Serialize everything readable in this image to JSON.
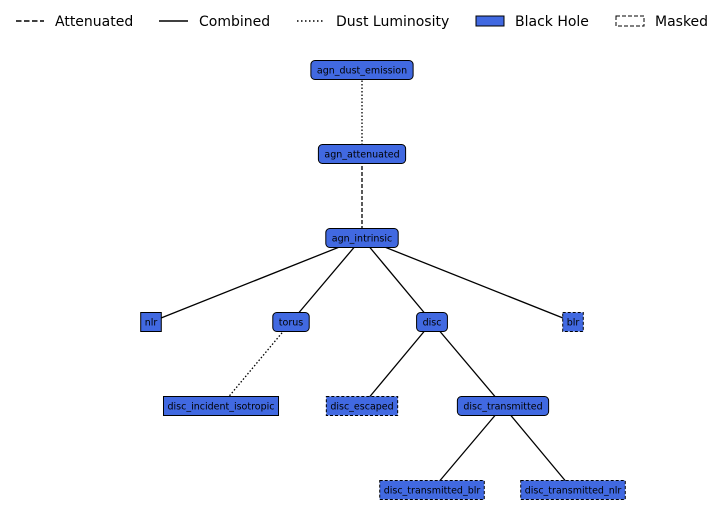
{
  "colors": {
    "node_fill": "#4169e1",
    "edge": "#000000",
    "background": "#ffffff"
  },
  "legend": [
    {
      "label": "Attenuated",
      "style": "dashed-line"
    },
    {
      "label": "Combined",
      "style": "solid-line"
    },
    {
      "label": "Dust Luminosity",
      "style": "dotted-line"
    },
    {
      "label": "Black Hole",
      "style": "filled-box"
    },
    {
      "label": "Masked",
      "style": "dashed-box"
    }
  ],
  "nodes": [
    {
      "id": "agn_dust_emission",
      "label": "agn_dust_emission",
      "shape": "rounded",
      "masked": false
    },
    {
      "id": "agn_attenuated",
      "label": "agn_attenuated",
      "shape": "rounded",
      "masked": false
    },
    {
      "id": "agn_intrinsic",
      "label": "agn_intrinsic",
      "shape": "rounded",
      "masked": false
    },
    {
      "id": "nlr",
      "label": "nlr",
      "shape": "square",
      "masked": false
    },
    {
      "id": "torus",
      "label": "torus",
      "shape": "rounded",
      "masked": false
    },
    {
      "id": "disc",
      "label": "disc",
      "shape": "rounded",
      "masked": false
    },
    {
      "id": "blr",
      "label": "blr",
      "shape": "square",
      "masked": true
    },
    {
      "id": "disc_incident_isotropic",
      "label": "disc_incident_isotropic",
      "shape": "square",
      "masked": false
    },
    {
      "id": "disc_escaped",
      "label": "disc_escaped",
      "shape": "square",
      "masked": true
    },
    {
      "id": "disc_transmitted",
      "label": "disc_transmitted",
      "shape": "rounded",
      "masked": false
    },
    {
      "id": "disc_transmitted_blr",
      "label": "disc_transmitted_blr",
      "shape": "square",
      "masked": true
    },
    {
      "id": "disc_transmitted_nlr",
      "label": "disc_transmitted_nlr",
      "shape": "square",
      "masked": true
    }
  ],
  "edges": [
    {
      "from": "agn_dust_emission",
      "to": "agn_attenuated",
      "type": "dust"
    },
    {
      "from": "agn_attenuated",
      "to": "agn_intrinsic",
      "type": "attenuated"
    },
    {
      "from": "agn_intrinsic",
      "to": "nlr",
      "type": "combined"
    },
    {
      "from": "agn_intrinsic",
      "to": "torus",
      "type": "combined"
    },
    {
      "from": "agn_intrinsic",
      "to": "disc",
      "type": "combined"
    },
    {
      "from": "agn_intrinsic",
      "to": "blr",
      "type": "combined"
    },
    {
      "from": "torus",
      "to": "disc_incident_isotropic",
      "type": "dust"
    },
    {
      "from": "disc",
      "to": "disc_escaped",
      "type": "combined"
    },
    {
      "from": "disc",
      "to": "disc_transmitted",
      "type": "combined"
    },
    {
      "from": "disc_transmitted",
      "to": "disc_transmitted_blr",
      "type": "combined"
    },
    {
      "from": "disc_transmitted",
      "to": "disc_transmitted_nlr",
      "type": "combined"
    }
  ]
}
